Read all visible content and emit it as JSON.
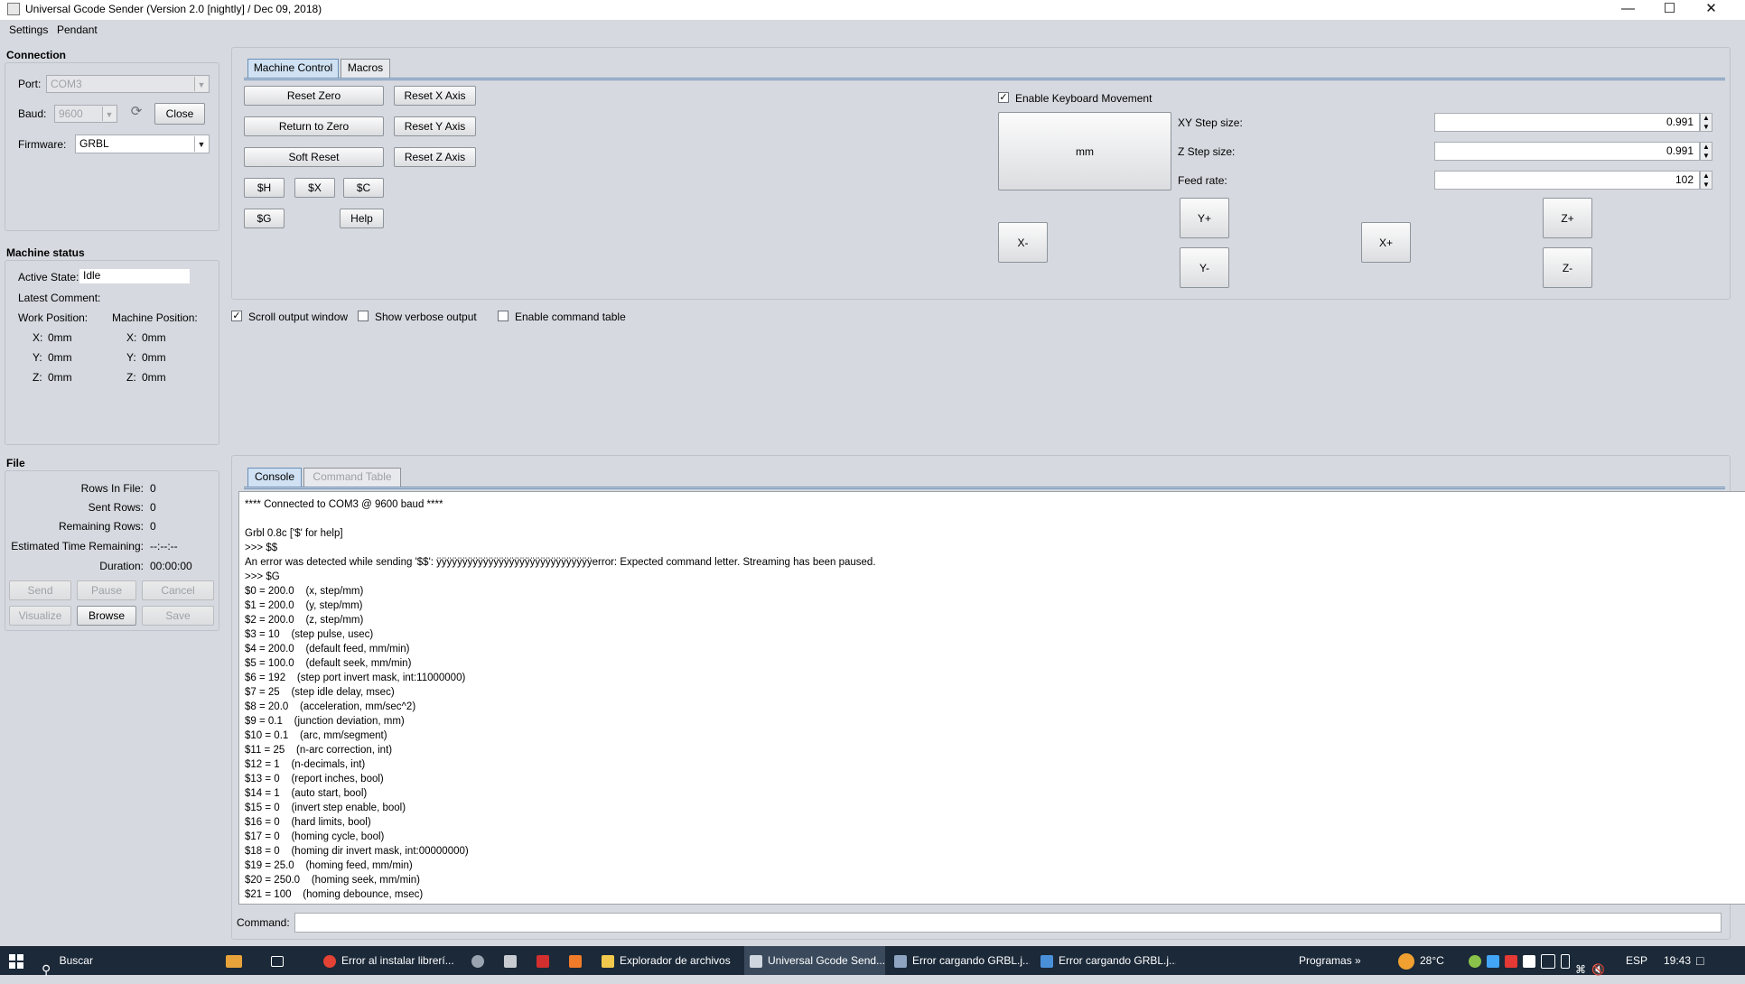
{
  "window": {
    "title": "Universal Gcode Sender (Version 2.0 [nightly]  / Dec 09, 2018)"
  },
  "menu": {
    "settings": "Settings",
    "pendant": "Pendant"
  },
  "connection": {
    "title": "Connection",
    "port_label": "Port:",
    "port_value": "COM3",
    "baud_label": "Baud:",
    "baud_value": "9600",
    "close_label": "Close",
    "firmware_label": "Firmware:",
    "firmware_value": "GRBL"
  },
  "machine_status": {
    "title": "Machine status",
    "active_state_label": "Active State:",
    "active_state_value": "Idle",
    "latest_comment_label": "Latest Comment:",
    "work_position_label": "Work Position:",
    "machine_position_label": "Machine Position:",
    "work": [
      {
        "axis": "X:",
        "value": "0mm"
      },
      {
        "axis": "Y:",
        "value": "0mm"
      },
      {
        "axis": "Z:",
        "value": "0mm"
      }
    ],
    "machine": [
      {
        "axis": "X:",
        "value": "0mm"
      },
      {
        "axis": "Y:",
        "value": "0mm"
      },
      {
        "axis": "Z:",
        "value": "0mm"
      }
    ]
  },
  "file": {
    "title": "File",
    "rows_in_file_label": "Rows In File:",
    "rows_in_file_value": "0",
    "sent_rows_label": "Sent Rows:",
    "sent_rows_value": "0",
    "remaining_rows_label": "Remaining Rows:",
    "remaining_rows_value": "0",
    "est_time_label": "Estimated Time Remaining:",
    "est_time_value": "--:--:--",
    "duration_label": "Duration:",
    "duration_value": "00:00:00",
    "send": "Send",
    "pause": "Pause",
    "cancel": "Cancel",
    "visualize": "Visualize",
    "browse": "Browse",
    "save": "Save"
  },
  "control_tabs": {
    "machine_control": "Machine Control",
    "macros": "Macros"
  },
  "machine_control": {
    "reset_zero": "Reset Zero",
    "return_to_zero": "Return to Zero",
    "soft_reset": "Soft Reset",
    "reset_x": "Reset X Axis",
    "reset_y": "Reset Y Axis",
    "reset_z": "Reset Z Axis",
    "sh": "$H",
    "sx": "$X",
    "sc": "$C",
    "sg": "$G",
    "help": "Help"
  },
  "jog": {
    "enable_keyboard": "Enable Keyboard Movement",
    "units": "mm",
    "xy_step_label": "XY Step size:",
    "xy_step_value": "0.991",
    "z_step_label": "Z Step size:",
    "z_step_value": "0.991",
    "feed_rate_label": "Feed rate:",
    "feed_rate_value": "102",
    "x_minus": "X-",
    "x_plus": "X+",
    "y_plus": "Y+",
    "y_minus": "Y-",
    "z_plus": "Z+",
    "z_minus": "Z-"
  },
  "options": {
    "scroll_output": "Scroll output window",
    "verbose": "Show verbose output",
    "command_table": "Enable command table"
  },
  "console_tabs": {
    "console": "Console",
    "command_table": "Command Table"
  },
  "console_lines": [
    "**** Connected to COM3 @ 9600 baud ****",
    "",
    "Grbl 0.8c ['$' for help]",
    ">>> $$",
    "An error was detected while sending '$$': ÿÿÿÿÿÿÿÿÿÿÿÿÿÿÿÿÿÿÿÿÿÿÿÿÿÿÿÿÿÿerror: Expected command letter. Streaming has been paused.",
    ">>> $G",
    "$0 = 200.0    (x, step/mm)",
    "$1 = 200.0    (y, step/mm)",
    "$2 = 200.0    (z, step/mm)",
    "$3 = 10    (step pulse, usec)",
    "$4 = 200.0    (default feed, mm/min)",
    "$5 = 100.0    (default seek, mm/min)",
    "$6 = 192    (step port invert mask, int:11000000)",
    "$7 = 25    (step idle delay, msec)",
    "$8 = 20.0    (acceleration, mm/sec^2)",
    "$9 = 0.1    (junction deviation, mm)",
    "$10 = 0.1    (arc, mm/segment)",
    "$11 = 25    (n-arc correction, int)",
    "$12 = 1    (n-decimals, int)",
    "$13 = 0    (report inches, bool)",
    "$14 = 1    (auto start, bool)",
    "$15 = 0    (invert step enable, bool)",
    "$16 = 0    (hard limits, bool)",
    "$17 = 0    (homing cycle, bool)",
    "$18 = 0    (homing dir invert mask, int:00000000)",
    "$19 = 25.0    (homing feed, mm/min)",
    "$20 = 250.0    (homing seek, mm/min)",
    "$21 = 100    (homing debounce, msec)"
  ],
  "command": {
    "label": "Command:",
    "value": ""
  },
  "taskbar": {
    "search": "Buscar",
    "apps": [
      "Error al instalar librerí...",
      "Explorador de archivos",
      "Universal Gcode Send...",
      "Error cargando GRBL.j...",
      "Error cargando GRBL.j..."
    ],
    "programs": "Programas",
    "temperature": "28°C",
    "lang": "ESP",
    "time": "19:43"
  }
}
